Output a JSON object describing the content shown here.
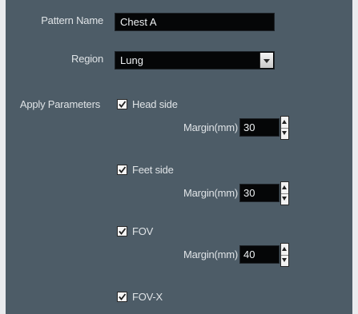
{
  "pattern_name": {
    "label": "Pattern Name",
    "value": "Chest A"
  },
  "region": {
    "label": "Region",
    "value": "Lung"
  },
  "apply_parameters": {
    "label": "Apply Parameters",
    "items": [
      {
        "label": "Head side",
        "checked": true,
        "margin_label": "Margin(mm)",
        "margin_value": "30"
      },
      {
        "label": "Feet side",
        "checked": true,
        "margin_label": "Margin(mm)",
        "margin_value": "30"
      },
      {
        "label": "FOV",
        "checked": true,
        "margin_label": "Margin(mm)",
        "margin_value": "40"
      },
      {
        "label": "FOV-X",
        "checked": true
      }
    ]
  },
  "colors": {
    "panel_bg": "#4d5c67",
    "field_bg": "#050607",
    "label_text": "#dfe3e6"
  }
}
